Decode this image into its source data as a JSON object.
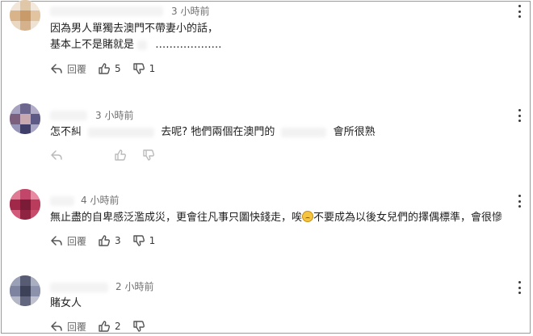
{
  "comments": [
    {
      "time": "3 小時前",
      "lines": [
        "因為男人單獨去澳門不帶妻小的話，",
        "基本上不是賭就是"
      ],
      "line2_tail": "……………….",
      "reply_label": "回覆",
      "likes": "5",
      "dislikes": "1"
    },
    {
      "time": "3 小時前",
      "text_a": "怎不糾",
      "text_b": "去呢? 牠們兩個在澳門的",
      "text_c": "會所很熟"
    },
    {
      "time": "4 小時前",
      "text_a": "無止盡的自卑感泛濫成災，更會往凡事只圖快錢走，唉",
      "text_b": "不要成為以後女兒們的擇偶標準，會很慘",
      "emoji": "sad-face-emoji",
      "reply_label": "回覆",
      "likes": "3",
      "dislikes": "1"
    },
    {
      "time": "2 小時前",
      "text": "賭女人",
      "reply_label": "回覆",
      "likes": "2",
      "dislikes": ""
    }
  ],
  "colors": {
    "text": "#1f1f1f",
    "muted": "#707070",
    "border": "#9a9a9a"
  }
}
